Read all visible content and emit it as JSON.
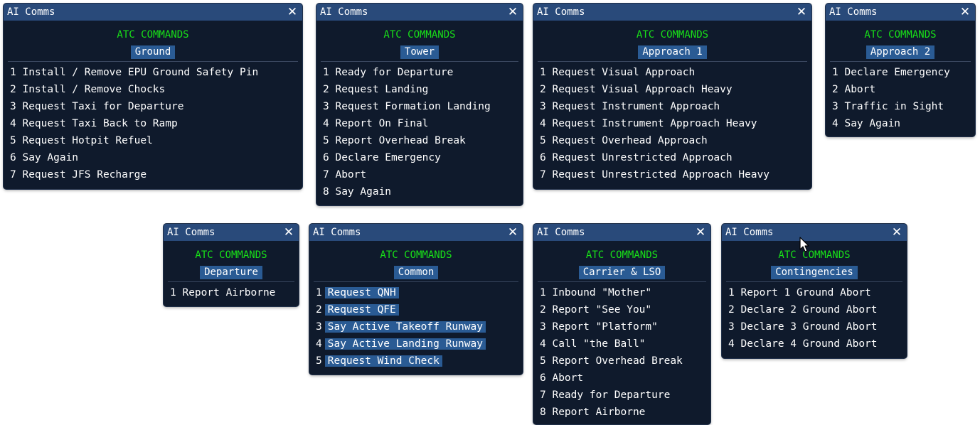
{
  "panels": {
    "ground": {
      "title": "AI Comms",
      "close": "✕",
      "header": "ATC COMMANDS",
      "section": "Ground",
      "items": [
        "1 Install / Remove EPU Ground Safety Pin",
        "2 Install / Remove Chocks",
        "3 Request Taxi for Departure",
        "4 Request Taxi Back to Ramp",
        "5 Request Hotpit Refuel",
        "6 Say Again",
        "7 Request JFS Recharge"
      ]
    },
    "tower": {
      "title": "AI Comms",
      "close": "✕",
      "header": "ATC COMMANDS",
      "section": "Tower",
      "items": [
        "1 Ready for Departure",
        "2 Request Landing",
        "3 Request Formation Landing",
        "4 Report On Final",
        "5 Report Overhead Break",
        "6 Declare Emergency",
        "7 Abort",
        "8 Say Again"
      ]
    },
    "approach1": {
      "title": "AI Comms",
      "close": "✕",
      "header": "ATC COMMANDS",
      "section": "Approach 1",
      "items": [
        "1 Request Visual Approach",
        "2 Request Visual Approach Heavy",
        "3 Request Instrument Approach",
        "4 Request Instrument Approach Heavy",
        "5 Request Overhead Approach",
        "6 Request Unrestricted Approach",
        "7 Request Unrestricted Approach Heavy"
      ]
    },
    "approach2": {
      "title": "AI Comms",
      "close": "✕",
      "header": "ATC COMMANDS",
      "section": "Approach 2",
      "items": [
        "1 Declare Emergency",
        "2 Abort",
        "3 Traffic in Sight",
        "4 Say Again"
      ]
    },
    "departure": {
      "title": "AI Comms",
      "close": "✕",
      "header": "ATC COMMANDS",
      "section": "Departure",
      "items": [
        "1 Report Airborne"
      ]
    },
    "common": {
      "title": "AI Comms",
      "close": "✕",
      "header": "ATC COMMANDS",
      "section": "Common",
      "items": [
        {
          "num": "1",
          "label": "Request QNH"
        },
        {
          "num": "2",
          "label": "Request QFE"
        },
        {
          "num": "3",
          "label": "Say Active Takeoff Runway"
        },
        {
          "num": "4",
          "label": "Say Active Landing Runway"
        },
        {
          "num": "5",
          "label": "Request Wind Check"
        }
      ]
    },
    "carrier": {
      "title": "AI Comms",
      "close": "✕",
      "header": "ATC COMMANDS",
      "section": "Carrier & LSO",
      "items": [
        "1 Inbound \"Mother\"",
        "2 Report \"See You\"",
        "3 Report \"Platform\"",
        "4 Call \"the Ball\"",
        "5 Report Overhead Break",
        "6 Abort",
        "7 Ready for Departure",
        "8 Report Airborne"
      ]
    },
    "contingencies": {
      "title": "AI Comms",
      "close": "✕",
      "header": "ATC COMMANDS",
      "section": "Contingencies",
      "items": [
        "1 Report 1 Ground Abort",
        "2 Declare 2 Ground Abort",
        "3 Declare 3 Ground Abort",
        "4 Declare 4 Ground Abort"
      ]
    }
  },
  "colors": {
    "panel_bg": "#0f1a2c",
    "titlebar_bg": "#294a7a",
    "header_green": "#18e018",
    "section_bg": "#2a5b94",
    "text": "#ffffff"
  }
}
